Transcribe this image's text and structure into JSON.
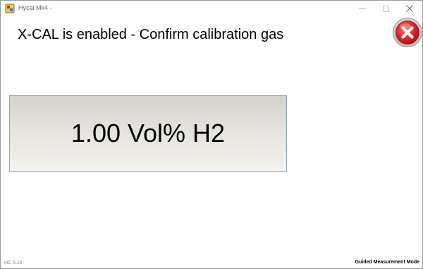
{
  "window": {
    "title": "Hycal Mk4 -",
    "controls": {
      "minimize_icon": "minimize-icon",
      "maximize_icon": "maximize-icon",
      "close_icon": "close-icon"
    }
  },
  "main": {
    "heading": "X-CAL is enabled - Confirm calibration gas",
    "gas_button_label": "1.00 Vol% H2",
    "cancel_icon": "red-x-circle-icon"
  },
  "footer": {
    "version": "HC 5.16",
    "mode": "Guided Measurement Mode"
  },
  "colors": {
    "cancel_red": "#d9252a",
    "button_gradient_top": "#d5d2cc",
    "button_gradient_bottom": "#f4f3ef",
    "button_border": "#8fa3b8"
  }
}
